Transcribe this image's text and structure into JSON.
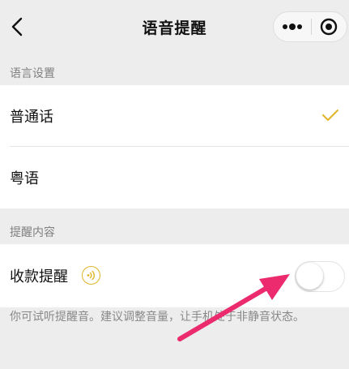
{
  "navbar": {
    "title": "语音提醒",
    "back_icon": "chevron-left-icon",
    "more_icon": "more-dots-icon",
    "close_icon": "target-circle-icon"
  },
  "language_section": {
    "header": "语言设置",
    "options": [
      {
        "label": "普通话",
        "selected": true
      },
      {
        "label": "粤语",
        "selected": false
      }
    ]
  },
  "reminder_section": {
    "header": "提醒内容",
    "item": {
      "label": "收款提醒",
      "sound_icon": "sound-wave-icon",
      "toggle_on": false
    },
    "hint": "你可试听提醒音。建议调整音量，让手机处于非静音状态。"
  },
  "colors": {
    "background": "#ededed",
    "accent": "#e0b42a",
    "annotation_arrow": "#ec2a6e"
  }
}
